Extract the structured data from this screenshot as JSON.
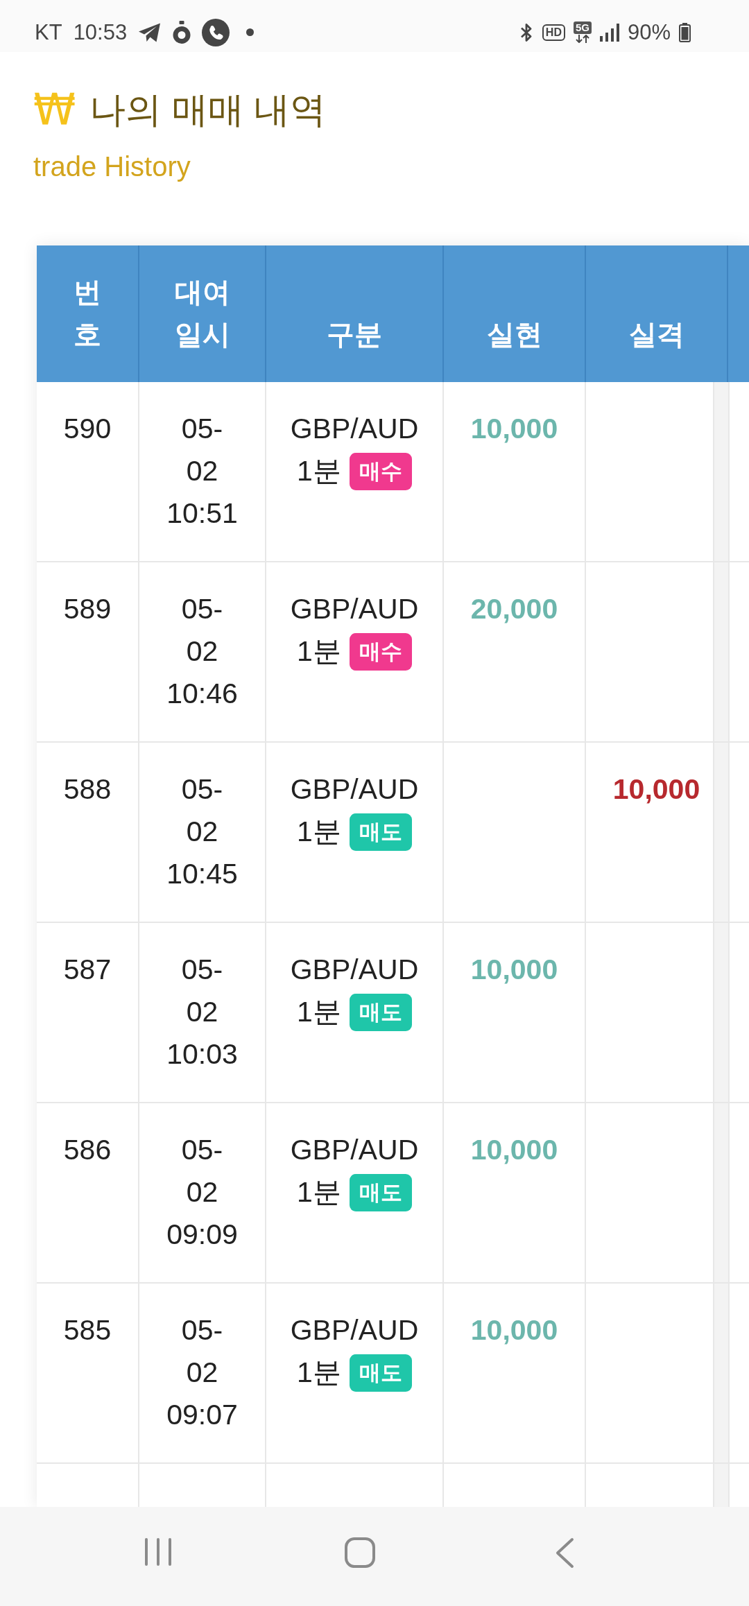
{
  "status_bar": {
    "carrier": "KT",
    "time": "10:53",
    "hd": "HD",
    "network": "5G",
    "battery": "90%"
  },
  "header": {
    "symbol": "₩",
    "title": "나의 매매 내역",
    "subtitle": "trade History"
  },
  "table": {
    "columns": [
      "번호",
      "대여일시",
      "구분",
      "실현",
      "실격"
    ],
    "rows": [
      {
        "number": "590",
        "datetime": "05-02 10:51",
        "pair": "GBP/AUD",
        "period": "1분",
        "tag": {
          "label": "매수",
          "color": "#f0398e"
        },
        "realized": "10,000"
      },
      {
        "number": "589",
        "datetime": "05-02 10:46",
        "pair": "GBP/AUD",
        "period": "1분",
        "tag": {
          "label": "매수",
          "color": "#f0398e"
        },
        "realized": "20,000"
      },
      {
        "number": "588",
        "datetime": "05-02 10:45",
        "pair": "GBP/AUD",
        "period": "1분",
        "tag": {
          "label": "매도",
          "color": "#1fc6a9"
        },
        "disqualified": "10,000"
      },
      {
        "number": "587",
        "datetime": "05-02 10:03",
        "pair": "GBP/AUD",
        "period": "1분",
        "tag": {
          "label": "매도",
          "color": "#1fc6a9"
        },
        "realized": "10,000"
      },
      {
        "number": "586",
        "datetime": "05-02 09:09",
        "pair": "GBP/AUD",
        "period": "1분",
        "tag": {
          "label": "매도",
          "color": "#1fc6a9"
        },
        "realized": "10,000"
      },
      {
        "number": "585",
        "datetime": "05-02 09:07",
        "pair": "GBP/AUD",
        "period": "1분",
        "tag": {
          "label": "매도",
          "color": "#1fc6a9"
        },
        "realized": "10,000"
      }
    ]
  }
}
